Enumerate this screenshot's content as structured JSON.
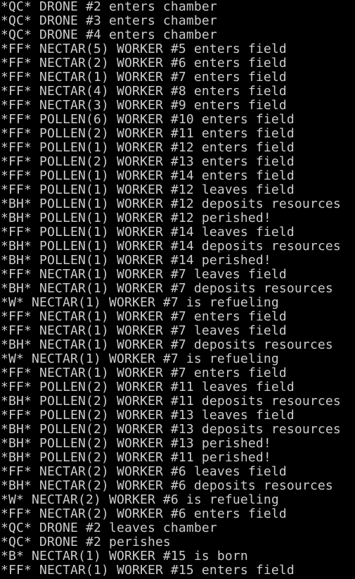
{
  "terminal": {
    "lines": [
      "*QC* DRONE #2 enters chamber",
      "*QC* DRONE #3 enters chamber",
      "*QC* DRONE #4 enters chamber",
      "*FF* NECTAR(5) WORKER #5 enters field",
      "*FF* NECTAR(2) WORKER #6 enters field",
      "*FF* NECTAR(1) WORKER #7 enters field",
      "*FF* NECTAR(4) WORKER #8 enters field",
      "*FF* NECTAR(3) WORKER #9 enters field",
      "*FF* POLLEN(6) WORKER #10 enters field",
      "*FF* POLLEN(2) WORKER #11 enters field",
      "*FF* POLLEN(1) WORKER #12 enters field",
      "*FF* POLLEN(2) WORKER #13 enters field",
      "*FF* POLLEN(1) WORKER #14 enters field",
      "*FF* POLLEN(1) WORKER #12 leaves field",
      "*BH* POLLEN(1) WORKER #12 deposits resources",
      "*BH* POLLEN(1) WORKER #12 perished!",
      "*FF* POLLEN(1) WORKER #14 leaves field",
      "*BH* POLLEN(1) WORKER #14 deposits resources",
      "*BH* POLLEN(1) WORKER #14 perished!",
      "*FF* NECTAR(1) WORKER #7 leaves field",
      "*BH* NECTAR(1) WORKER #7 deposits resources",
      "*W* NECTAR(1) WORKER #7 is refueling",
      "*FF* NECTAR(1) WORKER #7 enters field",
      "*FF* NECTAR(1) WORKER #7 leaves field",
      "*BH* NECTAR(1) WORKER #7 deposits resources",
      "*W* NECTAR(1) WORKER #7 is refueling",
      "*FF* NECTAR(1) WORKER #7 enters field",
      "*FF* POLLEN(2) WORKER #11 leaves field",
      "*BH* POLLEN(2) WORKER #11 deposits resources",
      "*FF* POLLEN(2) WORKER #13 leaves field",
      "*BH* POLLEN(2) WORKER #13 deposits resources",
      "*BH* POLLEN(2) WORKER #13 perished!",
      "*BH* POLLEN(2) WORKER #11 perished!",
      "*FF* NECTAR(2) WORKER #6 leaves field",
      "*BH* NECTAR(2) WORKER #6 deposits resources",
      "*W* NECTAR(2) WORKER #6 is refueling",
      "*FF* NECTAR(2) WORKER #6 enters field",
      "*QC* DRONE #2 leaves chamber",
      "*QC* DRONE #2 perishes",
      "*B* NECTAR(1) WORKER #15 is born",
      "*FF* NECTAR(1) WORKER #15 enters field"
    ],
    "colors": {
      "background": "#000000",
      "text": "#cccccc"
    }
  }
}
